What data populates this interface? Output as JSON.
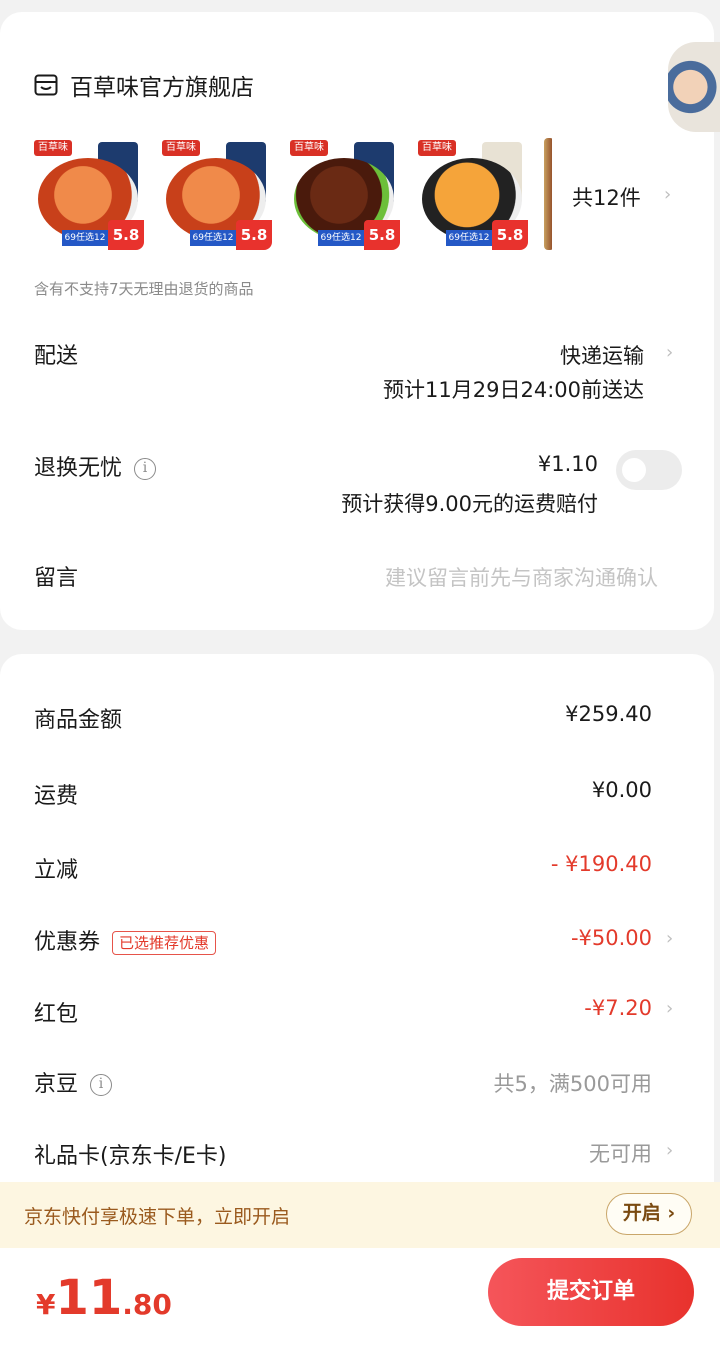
{
  "store": {
    "name": "百草味官方旗舰店",
    "icon": "store-icon"
  },
  "products": [
    {
      "brand": "百草味",
      "promo": "69任选12件",
      "price": "5.8",
      "colors": {
        "bowl": "#d8502a",
        "pack": "#1d3b6e"
      }
    },
    {
      "brand": "百草味",
      "promo": "69任选12件",
      "price": "5.8",
      "colors": {
        "bowl": "#d8502a",
        "pack": "#1d3b6e"
      }
    },
    {
      "brand": "百草味",
      "promo": "69任选12件",
      "price": "5.8",
      "colors": {
        "bowl": "#5a2a18",
        "pack": "#1d3b6e"
      }
    },
    {
      "brand": "百草味",
      "promo": "69任选12件",
      "price": "5.8",
      "colors": {
        "bowl": "#e8891e",
        "pack": "#e8e2d4"
      }
    }
  ],
  "item_count": "共12件",
  "return_note": "含有不支持7天无理由退货的商品",
  "delivery": {
    "label": "配送",
    "method": "快递运输",
    "eta": "预计11月29日24:00前送达"
  },
  "exchange": {
    "label": "退换无忧",
    "price": "¥1.10",
    "note": "预计获得9.00元的运费赔付",
    "enabled": false
  },
  "message": {
    "label": "留言",
    "placeholder": "建议留言前先与商家沟通确认"
  },
  "summary": {
    "goods": {
      "label": "商品金额",
      "value": "¥259.40"
    },
    "shipping": {
      "label": "运费",
      "value": "¥0.00"
    },
    "discount": {
      "label": "立减",
      "value": "- ¥190.40"
    },
    "coupon": {
      "label": "优惠券",
      "badge": "已选推荐优惠",
      "value": "-¥50.00"
    },
    "redpacket": {
      "label": "红包",
      "value": "-¥7.20"
    },
    "jingdou": {
      "label": "京豆",
      "value": "共5，满500可用"
    },
    "giftcard": {
      "label": "礼品卡(京东卡/E卡)",
      "value": "无可用"
    }
  },
  "fastpay": {
    "text": "京东快付享极速下单，立即开启",
    "button": "开启"
  },
  "total": {
    "currency": "¥",
    "integer": "11",
    "decimal": ".80"
  },
  "submit": "提交订单",
  "colors": {
    "accent": "#e33a2b",
    "fastpay_bg": "#fdf6e1"
  }
}
